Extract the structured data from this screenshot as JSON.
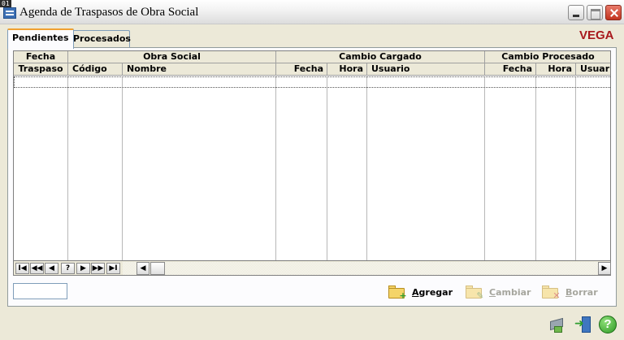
{
  "badge": "01",
  "window": {
    "title": "Agenda de Traspasos de Obra Social"
  },
  "tabs": [
    {
      "label": "Pendientes",
      "active": true
    },
    {
      "label": "Procesados",
      "active": false
    }
  ],
  "brand": "VEGA",
  "grid": {
    "group_headers": {
      "fecha": "Fecha",
      "obra_social": "Obra Social",
      "cambio_cargado": "Cambio Cargado",
      "cambio_procesado": "Cambio Procesado"
    },
    "columns": {
      "traspaso": "Traspaso",
      "codigo": "Código",
      "nombre": "Nombre",
      "cc_fecha": "Fecha",
      "cc_hora": "Hora",
      "cc_usuario": "Usuario",
      "cp_fecha": "Fecha",
      "cp_hora": "Hora",
      "cp_usuario": "Usuari"
    },
    "rows": []
  },
  "navigator": {
    "first": "I◀",
    "prev_page": "◀◀",
    "prev": "◀",
    "search": "?",
    "next": "▶",
    "next_page": "▶▶",
    "last": "▶I"
  },
  "filter_input": {
    "value": ""
  },
  "actions": {
    "agregar": {
      "label": "Agregar",
      "underline": "A",
      "rest": "gregar",
      "enabled": true
    },
    "cambiar": {
      "label": "Cambiar",
      "underline": "C",
      "rest": "ambiar",
      "enabled": false
    },
    "borrar": {
      "label": "Borrar",
      "underline": "B",
      "rest": "orrar",
      "enabled": false
    }
  },
  "icons": {
    "print": "print-icon",
    "exit": "exit-icon",
    "help": "help-icon"
  },
  "colors": {
    "brand": "#a8181c",
    "tab_accent": "#f0a030"
  }
}
